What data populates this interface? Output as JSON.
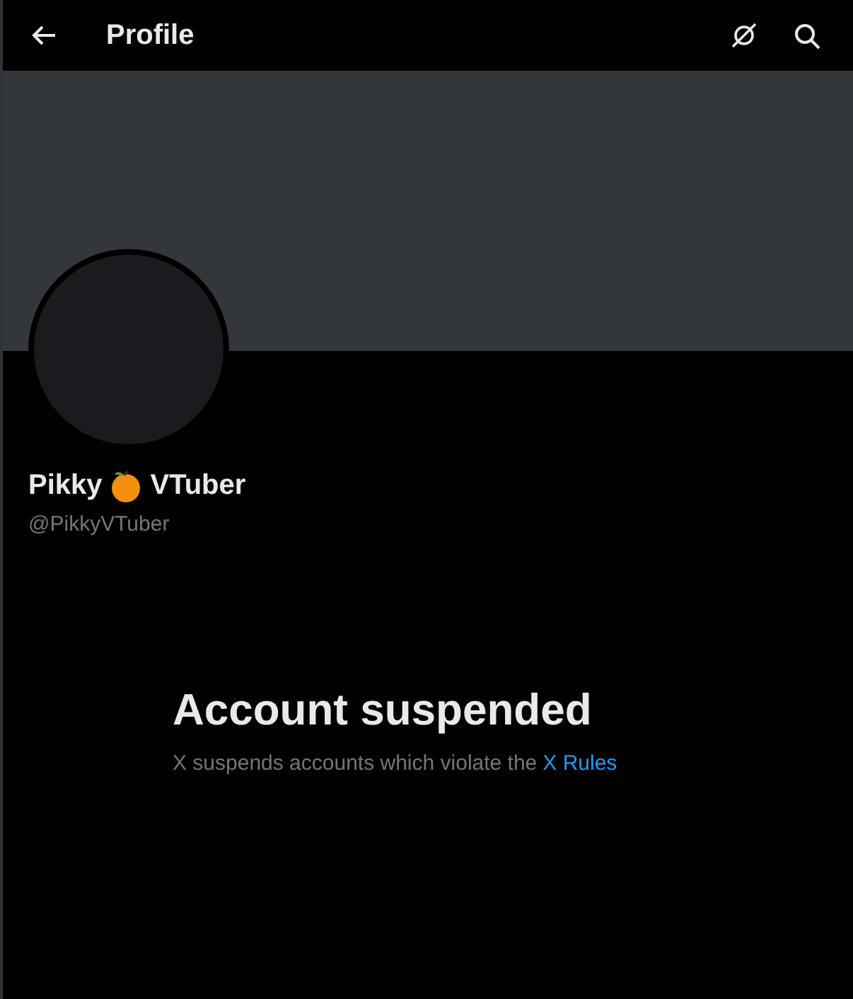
{
  "header": {
    "title": "Profile"
  },
  "profile": {
    "name_start": "Pikky",
    "name_end": "VTuber",
    "handle": "@PikkyVTuber"
  },
  "notice": {
    "title": "Account suspended",
    "text": "X suspends accounts which violate the",
    "link": "X Rules"
  }
}
